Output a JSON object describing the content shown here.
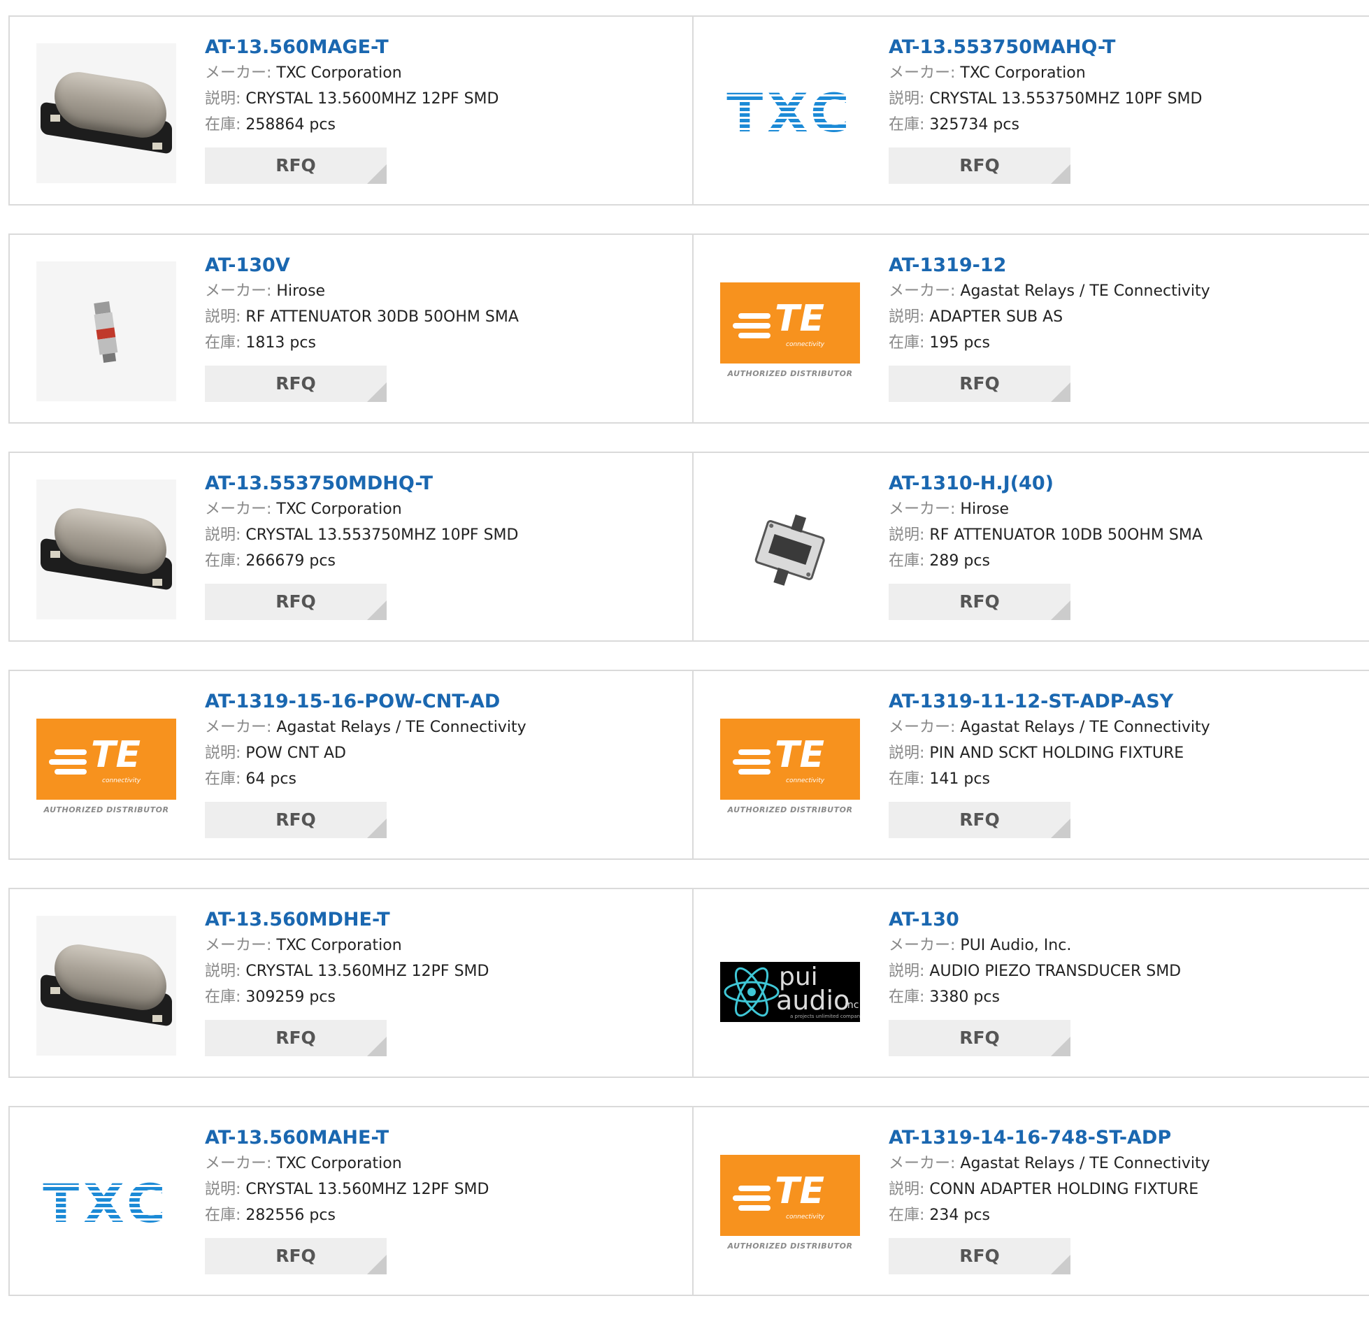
{
  "labels": {
    "maker": "メーカー:",
    "desc": "説明:",
    "stock": "在庫:",
    "rfq": "RFQ"
  },
  "logos": {
    "txc": "TXC",
    "te": "TE",
    "te_sub": "connectivity",
    "te_auth": "AUTHORIZED DISTRIBUTOR",
    "pui_1": "pui",
    "pui_2": "audio",
    "pui_3": "inc",
    "pui_4": "a projects unlimited company"
  },
  "colors": {
    "part_link": "#1a67b0",
    "te_orange": "#f7921e",
    "txc_blue": "#1c8ad6"
  },
  "products": [
    {
      "part": "AT-13.560MAGE-T",
      "maker": "TXC Corporation",
      "desc": "CRYSTAL 13.5600MHZ 12PF SMD",
      "stock": "258864 pcs",
      "image": "crystal-image"
    },
    {
      "part": "AT-13.553750MAHQ-T",
      "maker": "TXC Corporation",
      "desc": "CRYSTAL 13.553750MHZ 10PF SMD",
      "stock": "325734 pcs",
      "image": "txc-logo"
    },
    {
      "part": "AT-130V",
      "maker": "Hirose",
      "desc": "RF ATTENUATOR 30DB 50OHM SMA",
      "stock": "1813 pcs",
      "image": "attenuator-image"
    },
    {
      "part": "AT-1319-12",
      "maker": "Agastat Relays / TE Connectivity",
      "desc": "ADAPTER SUB AS",
      "stock": "195 pcs",
      "image": "te-logo"
    },
    {
      "part": "AT-13.553750MDHQ-T",
      "maker": "TXC Corporation",
      "desc": "CRYSTAL 13.553750MHZ 10PF SMD",
      "stock": "266679 pcs",
      "image": "crystal-image"
    },
    {
      "part": "AT-1310-H.J(40)",
      "maker": "Hirose",
      "desc": "RF ATTENUATOR 10DB 50OHM SMA",
      "stock": "289 pcs",
      "image": "rf-module-image"
    },
    {
      "part": "AT-1319-15-16-POW-CNT-AD",
      "maker": "Agastat Relays / TE Connectivity",
      "desc": "POW CNT AD",
      "stock": "64 pcs",
      "image": "te-logo"
    },
    {
      "part": "AT-1319-11-12-ST-ADP-ASY",
      "maker": "Agastat Relays / TE Connectivity",
      "desc": "PIN AND SCKT HOLDING FIXTURE",
      "stock": "141 pcs",
      "image": "te-logo"
    },
    {
      "part": "AT-13.560MDHE-T",
      "maker": "TXC Corporation",
      "desc": "CRYSTAL 13.560MHZ 12PF SMD",
      "stock": "309259 pcs",
      "image": "crystal-image"
    },
    {
      "part": "AT-130",
      "maker": "PUI Audio, Inc.",
      "desc": "AUDIO PIEZO TRANSDUCER SMD",
      "stock": "3380 pcs",
      "image": "pui-audio-logo"
    },
    {
      "part": "AT-13.560MAHE-T",
      "maker": "TXC Corporation",
      "desc": "CRYSTAL 13.560MHZ 12PF SMD",
      "stock": "282556 pcs",
      "image": "txc-logo"
    },
    {
      "part": "AT-1319-14-16-748-ST-ADP",
      "maker": "Agastat Relays / TE Connectivity",
      "desc": "CONN ADAPTER HOLDING FIXTURE",
      "stock": "234 pcs",
      "image": "te-logo"
    }
  ]
}
